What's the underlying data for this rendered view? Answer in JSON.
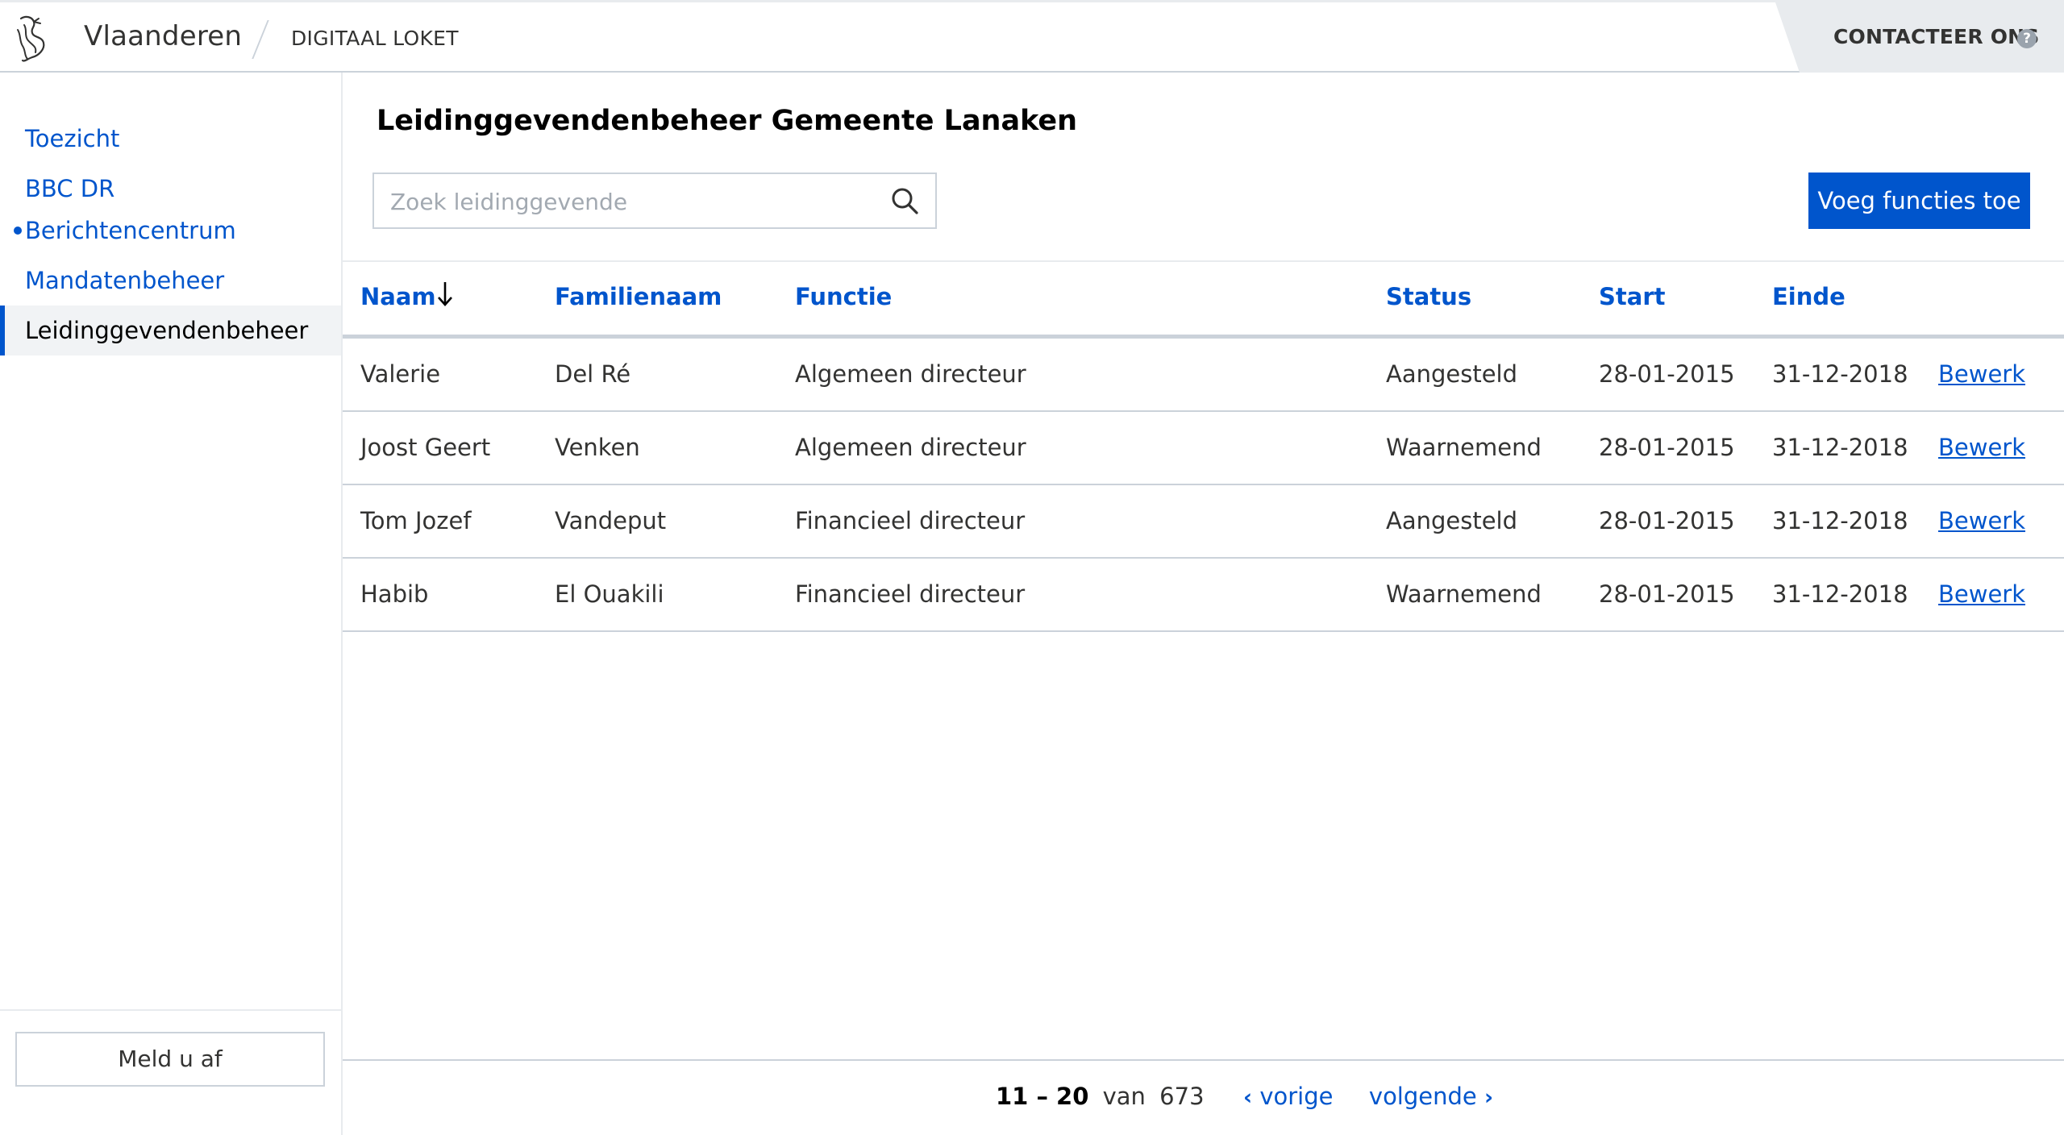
{
  "header": {
    "brand": "Vlaanderen",
    "app_name": "DIGITAAL LOKET",
    "contact_label": "CONTACTEER ONS",
    "help_glyph": "?"
  },
  "sidebar": {
    "items": [
      {
        "label": "Toezicht",
        "active": false
      },
      {
        "label": "BBC DR",
        "active": false
      },
      {
        "label": "Berichtencentrum",
        "active": false,
        "unread_dot": true
      },
      {
        "label": "Mandatenbeheer",
        "active": false
      },
      {
        "label": "Leidinggevendenbeheer",
        "active": true
      }
    ],
    "logout_label": "Meld u af"
  },
  "main": {
    "title": "Leidinggevendenbeheer Gemeente Lanaken",
    "search_placeholder": "Zoek leidinggevende",
    "search_value": "",
    "add_button": "Voeg functies toe",
    "table": {
      "columns": [
        "Naam",
        "Familienaam",
        "Functie",
        "Status",
        "Start",
        "Einde"
      ],
      "sorted_column": "Naam",
      "sort_direction": "descending",
      "edit_label": "Bewerk",
      "rows": [
        {
          "naam": "Valerie",
          "familienaam": "Del Ré",
          "functie": "Algemeen directeur",
          "status": "Aangesteld",
          "start": "28-01-2015",
          "einde": "31-12-2018"
        },
        {
          "naam": "Joost Geert",
          "familienaam": "Venken",
          "functie": "Algemeen directeur",
          "status": "Waarnemend",
          "start": "28-01-2015",
          "einde": "31-12-2018"
        },
        {
          "naam": "Tom Jozef",
          "familienaam": "Vandeput",
          "functie": "Financieel directeur",
          "status": "Aangesteld",
          "start": "28-01-2015",
          "einde": "31-12-2018"
        },
        {
          "naam": "Habib",
          "familienaam": "El Ouakili",
          "functie": "Financieel directeur",
          "status": "Waarnemend",
          "start": "28-01-2015",
          "einde": "31-12-2018"
        }
      ]
    },
    "pagination": {
      "range": "11 – 20",
      "of_label": "van",
      "total": "673",
      "prev_label": "vorige",
      "next_label": "volgende"
    }
  },
  "colors": {
    "accent": "#0055cc",
    "text": "#333332",
    "border": "#cbd2da",
    "light_bg": "#e8ebee"
  },
  "icons": [
    "flemish-lion-logo",
    "help-icon",
    "search-icon",
    "sort-down-arrow-icon",
    "chevron-left-icon",
    "chevron-right-icon"
  ]
}
